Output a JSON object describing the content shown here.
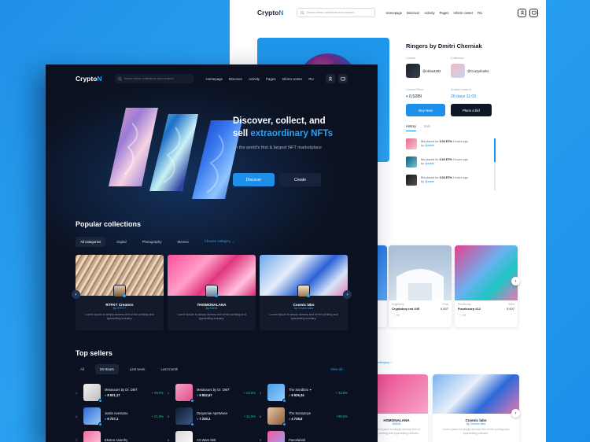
{
  "light": {
    "logo": "Crypto",
    "logo_accent": "N",
    "search_placeholder": "Search items, collections and creators",
    "menu": [
      "Homepage",
      "Discover",
      "Activity",
      "Pages",
      "Inform center",
      "RU"
    ],
    "title": "Ringers by Dmitri Cherniak",
    "creator_label": "Creator",
    "creator_name": "@nikita3283",
    "collection_label": "Collection",
    "collection_name": "@Crazysharks",
    "price_label": "Current Price",
    "price_value": "0,5289",
    "auction_label": "Auction ends in",
    "auction_value": "26 days 11:05",
    "buy_label": "Buy Now",
    "bid_label": "Place a bid",
    "tabs": [
      "History",
      "Bids"
    ],
    "history": [
      {
        "text": "Bid placed for",
        "amount": "0.03 ETH",
        "time": "4 hours ago",
        "by": "by",
        "user": "@arktk"
      },
      {
        "text": "Bid placed for",
        "amount": "0.03 ETH",
        "time": "4 hours ago",
        "by": "by",
        "user": "@arktk"
      },
      {
        "text": "Bid placed for",
        "amount": "0.03 ETH",
        "time": "4 hours ago",
        "by": "by",
        "user": "@arktk"
      }
    ],
    "cards": [
      {
        "creator": "Cryptoboy",
        "name": "Cryptoboy red #45",
        "price_label": "Price",
        "price": "0,007",
        "likes": "99"
      },
      {
        "creator": "Puzzlecorp",
        "name": "Puzzlecorp #12",
        "price_label": "Price",
        "price": "0,007",
        "likes": "99"
      }
    ],
    "category_link": "category",
    "bottom_card": {
      "title": "Cosmic labs",
      "by": "by",
      "user": "Cosmic labs",
      "desc": "Lorem Ipsum is simply dummy text of the printing and typesetting industry."
    },
    "left_partial": {
      "title": "HSMONALANA",
      "user": "ANNA",
      "desc": "Lorem Ipsum is simply dummy text of the printing and typesetting industry."
    }
  },
  "dark": {
    "logo": "Crypto",
    "logo_accent": "N",
    "search_placeholder": "Search items collections and creators",
    "menu": [
      "Homepage",
      "Discover",
      "Activity",
      "Pages",
      "Inform center",
      "RU"
    ],
    "hero_title_1": "Discover, collect, and",
    "hero_title_2": "sell ",
    "hero_title_accent": "extraordinary NFTs",
    "hero_sub": "on the world's first & largest NFT marketplace",
    "discover_label": "Discover",
    "create_label": "Create",
    "popular_title": "Popular collections",
    "popular_chips": [
      "All categories",
      "Digital",
      "Photography",
      "Memes"
    ],
    "choose_category": "Choose category",
    "collections": [
      {
        "title": "RTFKT Creators",
        "by": "by",
        "user": "RTFKT",
        "desc": "Lorem Ipsum is simply dummy text of the printing and typesetting industry."
      },
      {
        "title": "THISMONALANA",
        "by": "by",
        "user": "ANNA",
        "desc": "Lorem Ipsum is simply dummy text of the printing and typesetting industry."
      },
      {
        "title": "Cosmic labs",
        "by": "by",
        "user": "Cosmic labs",
        "desc": "Lorem Ipsum is simply dummy text of the printing and typesetting industry."
      }
    ],
    "sellers_title": "Top sellers",
    "seller_chips": [
      "All",
      "24 Hours",
      "Last week",
      "Last month"
    ],
    "view_all": "View all",
    "sellers": [
      {
        "n": "1",
        "name": "Metasaurs by Dr. DMT",
        "price": "8 921,17",
        "change": "+ 49,5%"
      },
      {
        "n": "2",
        "name": "Metasaurs by Dr. DMT",
        "price": "9 842,67",
        "change": "+ 23,5%"
      },
      {
        "n": "3",
        "name": "The Sandbox ✦",
        "price": "9 926,34",
        "change": "+ 33,8%"
      },
      {
        "n": "4",
        "name": "Justin Aversano",
        "price": "6 727,1",
        "change": "+ 21,5%"
      },
      {
        "n": "5",
        "name": "Desperate ApeWives",
        "price": "7 230,1",
        "change": "+ 11,5%"
      },
      {
        "n": "6",
        "name": "The Sunnytoye",
        "price": "4 728,9",
        "change": "+90,5%"
      },
      {
        "n": "7",
        "name": "Ekotne Anarchy",
        "price": "",
        "change": ""
      },
      {
        "n": "8",
        "name": "Art Wars 555",
        "price": "",
        "change": ""
      },
      {
        "n": "9",
        "name": "Parcelahah",
        "price": "",
        "change": ""
      }
    ]
  },
  "colors": {
    "accent": "#2aa2f0",
    "dark_bg": "#0b1120",
    "positive": "#27c27b"
  }
}
